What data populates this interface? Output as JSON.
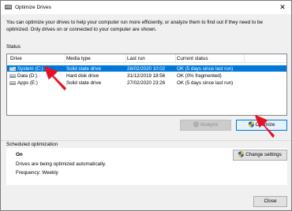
{
  "window": {
    "title": "Optimize Drives",
    "close_glyph": "✕"
  },
  "description": "You can optimize your drives to help your computer run more efficiently, or analyze them to find out if they need to be optimized. Only drives on or connected to your computer are shown.",
  "status": {
    "section_label": "Status",
    "columns": [
      "Drive",
      "Media type",
      "Last run",
      "Current status"
    ],
    "drives": [
      {
        "name": "System (C:)",
        "media": "Solid state drive",
        "last_run": "28/02/2020 10:02",
        "status": "OK (5 days since last run)",
        "icon": "system-drive-icon"
      },
      {
        "name": "Data (D:)",
        "media": "Hard disk drive",
        "last_run": "31/12/2019 18:56",
        "status": "OK (0% fragmented)",
        "icon": "drive-icon"
      },
      {
        "name": "Apps (E:)",
        "media": "Solid state drive",
        "last_run": "27/02/2020 23:26",
        "status": "OK (5 days since last run)",
        "icon": "drive-icon"
      }
    ],
    "selected_index": 0,
    "analyze_label": "Analyze",
    "optimize_label": "Optimize"
  },
  "scheduled": {
    "section_label": "Scheduled optimization",
    "state": "On",
    "info": "Drives are being optimized automatically.",
    "frequency": "Frequency: Weekly",
    "change_settings_label": "Change settings"
  },
  "footer": {
    "close_label": "Close"
  },
  "colors": {
    "selection": "#0078d7",
    "annotation_arrow": "#e81123"
  }
}
